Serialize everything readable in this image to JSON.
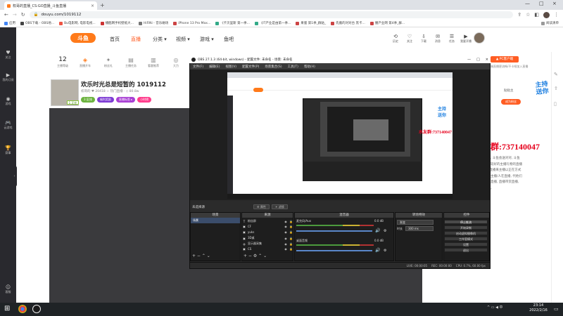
{
  "browser": {
    "tab_title": "权哥的直播_CS:GO直播_斗鱼直播",
    "tab_close": "×",
    "new_tab": "+",
    "win_controls": [
      "—",
      "□",
      "×"
    ],
    "url": "douyu.com/1019112",
    "bookmarks": [
      "应用",
      "OBS下载 - OBS地...",
      "Bu电影网, 电影电视...",
      "播酷网手机壁纸大...",
      "HiFiNi - 音乐磁场",
      "iPhone 13 Pro Max...",
      "《卡贝里斯 第一季...",
      "《IT产业是由第一季...",
      "果骚 第1季_群贴_",
      "先搬的对对台 黑卡...",
      "腰产业网 第4季_群..."
    ],
    "reading_list": "阅读清单"
  },
  "site": {
    "logo_text": "斗鱼",
    "nav": [
      "首页",
      "直播",
      "分类 ▾",
      "视频 ▾",
      "游戏 ▾",
      "鱼吧"
    ],
    "nav_icons": [
      {
        "icon": "history-icon",
        "glyph": "⟲",
        "label": "历史"
      },
      {
        "icon": "follow-icon",
        "glyph": "♡",
        "label": "关注"
      },
      {
        "icon": "download-icon",
        "glyph": "⇩",
        "label": "下载"
      },
      {
        "icon": "message-icon",
        "glyph": "✉",
        "label": "消息"
      },
      {
        "icon": "task-icon",
        "glyph": "☰",
        "label": "任务"
      },
      {
        "icon": "live-start-icon",
        "glyph": "▶",
        "label": "我要开播"
      }
    ],
    "left_sidebar": [
      {
        "glyph": "♥",
        "label": "关注"
      },
      {
        "glyph": "▶",
        "label": "我的订阅"
      },
      {
        "glyph": "◉",
        "label": "游戏"
      },
      {
        "glyph": "🎮",
        "label": "云游戏"
      },
      {
        "glyph": "🏆",
        "label": "赛事"
      },
      {
        "glyph": "☺",
        "label": "客服"
      }
    ],
    "stats": [
      {
        "value": "12",
        "label": "主播等级"
      },
      {
        "value": "",
        "label": "直播开车"
      },
      {
        "value": "",
        "label": "粉丝礼"
      },
      {
        "value": "",
        "label": "主播任务"
      },
      {
        "value": "",
        "label": "看客推荐"
      },
      {
        "value": "",
        "label": "大力"
      }
    ],
    "room": {
      "title": "欢乐时光总是短暂的 1019112",
      "meta": "权哥的  ♥ 20418  ☆ 热门直播 · ◇ 80.8w",
      "thumb_badge": "1 正在",
      "tags": [
        {
          "text": "3 区排",
          "color": "#6cb33f"
        },
        {
          "text": "福利奖励",
          "color": "#7d3bd4"
        },
        {
          "text": "直播标签 ▸",
          "color": "#a83fd4"
        },
        {
          "text": "小时榜",
          "color": "#ff3c8c"
        }
      ]
    },
    "right_panel": {
      "pc_button": "▲ PC客户端",
      "line": "用客户端直播更流畅/不卡顿加入直播",
      "mid_text": "贴粘主",
      "follow_button": "成为粉丝",
      "badge_text": "主持 送你",
      "qq_group": "水友群:737140047",
      "notice": "礼物, 斗鱼会送对对, 斗鱼会比较好的主播礼物的直播间, 直播来主播以正在方式赞赏主播/人在直播, 代他们在在直播, 直播带货直播, 最请。"
    }
  },
  "obs": {
    "title": "OBS 27.1.3 (64-bit, windows) - 配置文件: 未命名 - 场景: 未命名",
    "controls": [
      "—",
      "□",
      "×"
    ],
    "menu": [
      "文件(F)",
      "编辑(E)",
      "视图(V)",
      "配置文件(P)",
      "场景集合(S)",
      "工具(T)",
      "帮助(H)"
    ],
    "no_source": "未选择源",
    "scene_buttons": [
      "⚙ 属性",
      "☀ 滤镜"
    ],
    "docks": {
      "scenes": {
        "title": "场景",
        "items": [
          "场景"
        ]
      },
      "sources": {
        "title": "来源",
        "items": [
          {
            "icon": "T",
            "name": "粉丝群"
          },
          {
            "icon": "▣",
            "name": "CF"
          },
          {
            "icon": "▣",
            "name": "yuks"
          },
          {
            "icon": "▣",
            "name": "3D桌"
          },
          {
            "icon": "◍",
            "name": "显示器采集"
          },
          {
            "icon": "▣",
            "name": "CS"
          }
        ]
      },
      "mixer": {
        "title": "混音器",
        "channels": [
          {
            "name": "麦克风/Aux",
            "db": "0.0 dB"
          },
          {
            "name": "桌面音频",
            "db": "0.0 dB"
          }
        ]
      },
      "transitions": {
        "title": "转场特效",
        "type": "渐变",
        "duration_label": "时长",
        "duration": "300 ms"
      },
      "controls": {
        "title": "控件",
        "buttons": [
          "停止推流",
          "开始录制",
          "启动虚拟摄像机",
          "工作室模式",
          "设置",
          "退出"
        ]
      }
    },
    "status": [
      "LIVE: 00:00:05",
      "REC: 00:00:00",
      "CPU: 0.7%, 60.00 fps"
    ],
    "preview_qq": "水友群:737140047",
    "preview_badge": "主持 送你"
  },
  "taskbar": {
    "start_glyph": "⊞",
    "time": "23:14",
    "date": "2022/2/16",
    "tray": "^ ▭ ◀ 中"
  }
}
